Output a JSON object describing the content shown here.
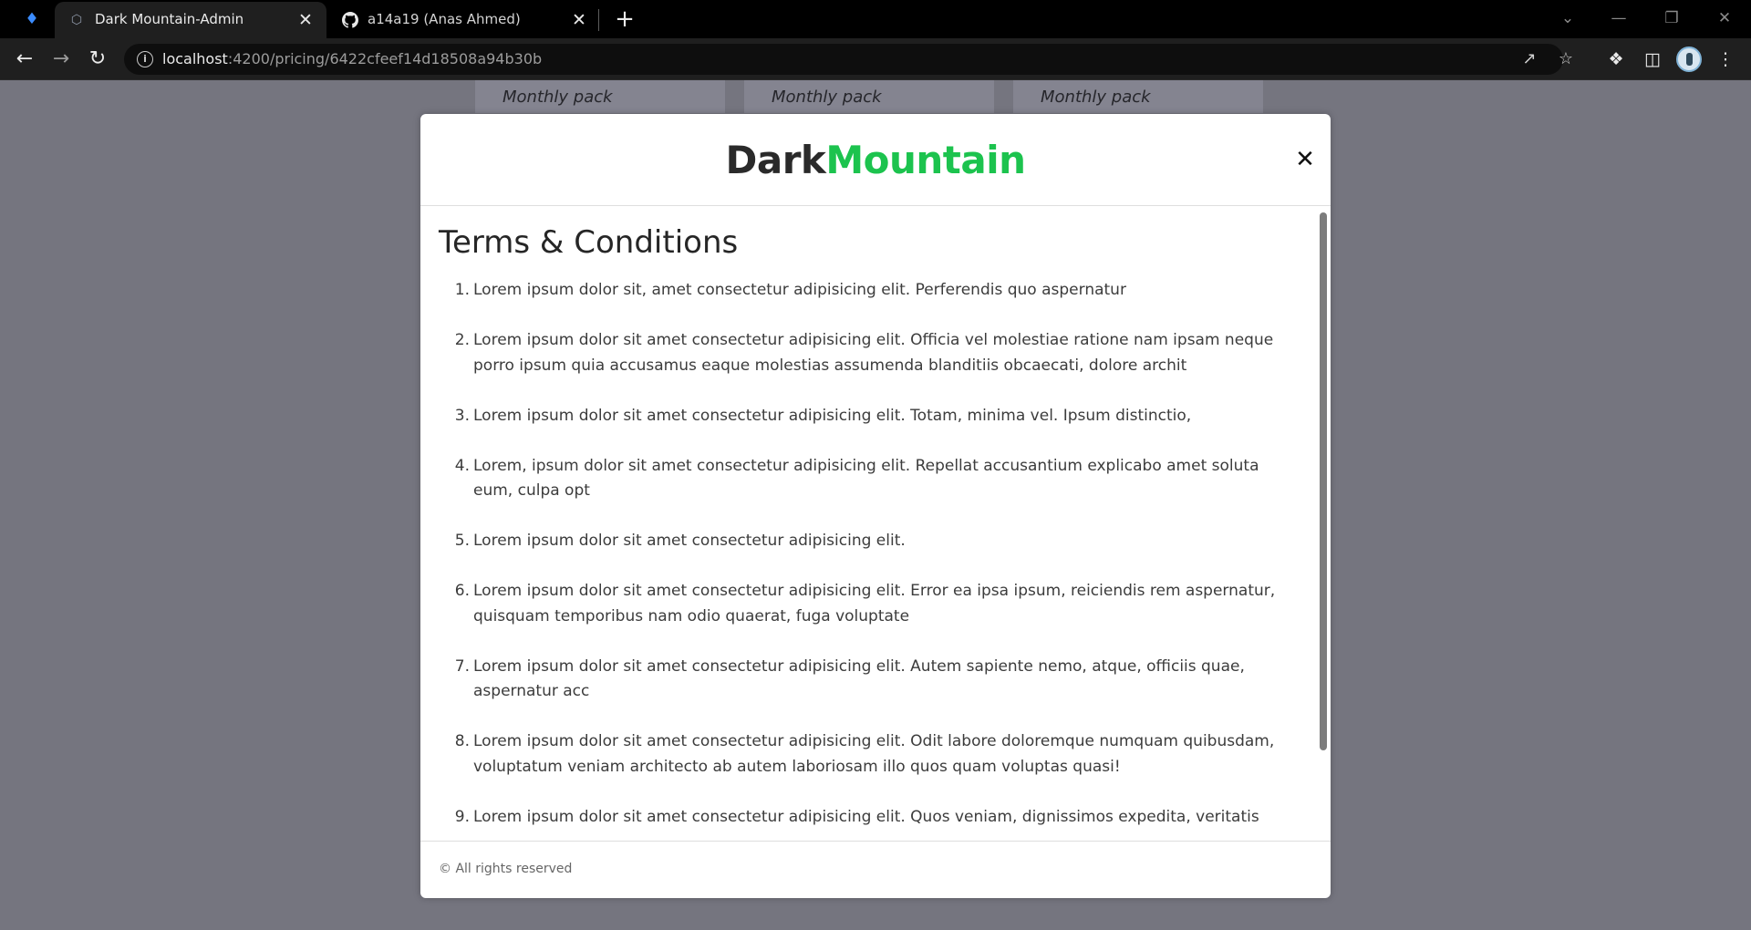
{
  "browser": {
    "tabs": [
      {
        "title": "Dark Mountain-Admin",
        "icon": "angular-icon",
        "active": true
      },
      {
        "title": "a14a19 (Anas Ahmed)",
        "icon": "github-icon",
        "active": false
      }
    ],
    "url_host": "localhost",
    "url_path": ":4200/pricing/6422cfeef14d18508a94b30b"
  },
  "page": {
    "pack_cards": [
      "Monthly pack",
      "Monthly pack",
      "Monthly pack"
    ]
  },
  "modal": {
    "brand_dark": "Dark",
    "brand_green": "Mountain",
    "brand_green_color": "#1cc34e",
    "title": "Terms & Conditions",
    "terms": [
      "Lorem ipsum dolor sit, amet consectetur adipisicing elit. Perferendis quo aspernatur",
      "Lorem ipsum dolor sit amet consectetur adipisicing elit. Officia vel molestiae ratione nam ipsam neque porro ipsum quia accusamus eaque molestias assumenda blanditiis obcaecati, dolore archit",
      "Lorem ipsum dolor sit amet consectetur adipisicing elit. Totam, minima vel. Ipsum distinctio,",
      "Lorem, ipsum dolor sit amet consectetur adipisicing elit. Repellat accusantium explicabo amet soluta eum, culpa opt",
      "Lorem ipsum dolor sit amet consectetur adipisicing elit.",
      "Lorem ipsum dolor sit amet consectetur adipisicing elit. Error ea ipsa ipsum, reiciendis rem aspernatur, quisquam temporibus nam odio quaerat, fuga voluptate",
      "Lorem ipsum dolor sit amet consectetur adipisicing elit. Autem sapiente nemo, atque, officiis quae, aspernatur acc",
      "Lorem ipsum dolor sit amet consectetur adipisicing elit. Odit labore doloremque numquam quibusdam, voluptatum veniam architecto ab autem laboriosam illo quos quam voluptas quasi!",
      "Lorem ipsum dolor sit amet consectetur adipisicing elit. Quos veniam, dignissimos expedita, veritatis"
    ],
    "footer": "© All rights reserved"
  }
}
